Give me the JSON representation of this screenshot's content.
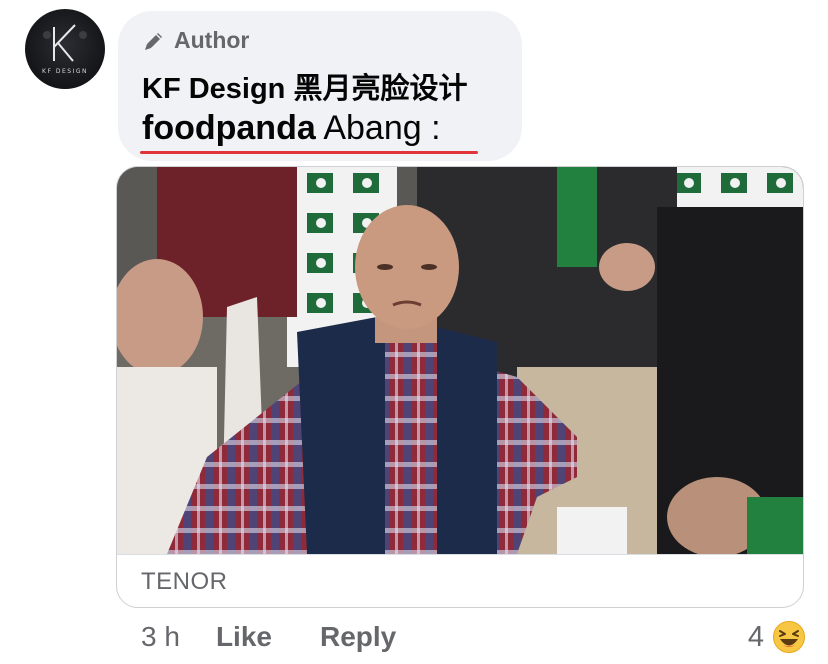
{
  "comment": {
    "author_badge": "Author",
    "author_badge_icon": "pencil-icon",
    "author_name": "KF Design 黑月亮脸设计",
    "text_brand": "foodpanda",
    "text_rest": " Abang :",
    "avatar_caption": "KF DESIGN"
  },
  "attachment": {
    "source_label": "TENOR"
  },
  "actions": {
    "timestamp": "3 h",
    "like_label": "Like",
    "reply_label": "Reply"
  },
  "reactions": {
    "count": "4",
    "icon": "laughing-emoji-icon"
  },
  "colors": {
    "bubble_bg": "#f0f2f5",
    "secondary_text": "#65676b",
    "spellcheck_underline": "#e0343a",
    "emoji_yellow": "#f7c743"
  }
}
